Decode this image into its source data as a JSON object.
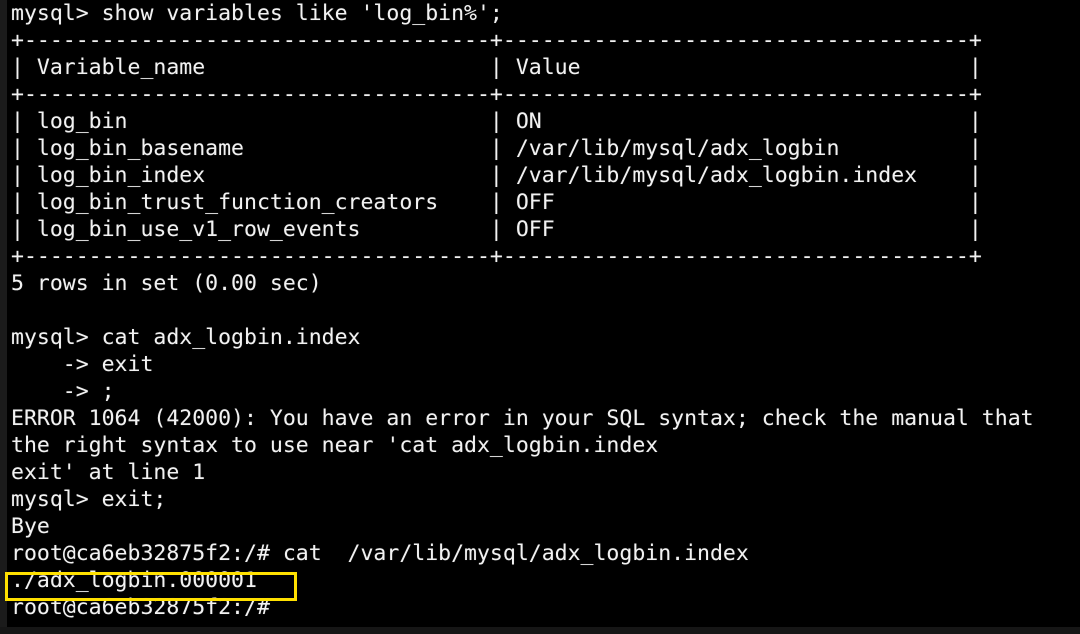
{
  "terminal": {
    "prompt_mysql": "mysql>",
    "prompt_shell": "root@ca6eb32875f2:/#",
    "continuation_prompt": "->",
    "highlight_color": "#ffe000",
    "foreground_color": "#f2f2f2",
    "background_color": "#000000"
  },
  "query": {
    "command_line": "mysql> show variables like 'log_bin%';"
  },
  "result_table": {
    "border_top": "+------------------------------------+------------------------------------+",
    "header_row": "| Variable_name                      | Value                              |",
    "border_header": "+------------------------------------+------------------------------------+",
    "columns": [
      "Variable_name",
      "Value"
    ],
    "rows": [
      {
        "line": "| log_bin                            | ON                                 |",
        "variable_name": "log_bin",
        "value": "ON"
      },
      {
        "line": "| log_bin_basename                   | /var/lib/mysql/adx_logbin          |",
        "variable_name": "log_bin_basename",
        "value": "/var/lib/mysql/adx_logbin"
      },
      {
        "line": "| log_bin_index                      | /var/lib/mysql/adx_logbin.index    |",
        "variable_name": "log_bin_index",
        "value": "/var/lib/mysql/adx_logbin.index"
      },
      {
        "line": "| log_bin_trust_function_creators    | OFF                                |",
        "variable_name": "log_bin_trust_function_creators",
        "value": "OFF"
      },
      {
        "line": "| log_bin_use_v1_row_events          | OFF                                |",
        "variable_name": "log_bin_use_v1_row_events",
        "value": "OFF"
      }
    ],
    "border_bottom": "+------------------------------------+------------------------------------+",
    "row_count_status": "5 rows in set (0.00 sec)"
  },
  "session": {
    "blank1": " ",
    "cat_attempt": "mysql> cat adx_logbin.index",
    "continuation_1": "    -> exit",
    "continuation_2": "    -> ;",
    "error_line_1": "ERROR 1064 (42000): You have an error in your SQL syntax; check the manual that",
    "error_line_2": "the right syntax to use near 'cat adx_logbin.index",
    "error_line_3": "exit' at line 1",
    "exit_command": "mysql> exit;",
    "bye": "Bye",
    "shell_cat_command": "root@ca6eb32875f2:/# cat  /var/lib/mysql/adx_logbin.index",
    "cat_output_highlighted": "./adx_logbin.000001",
    "final_prompt": "root@ca6eb32875f2:/#"
  }
}
